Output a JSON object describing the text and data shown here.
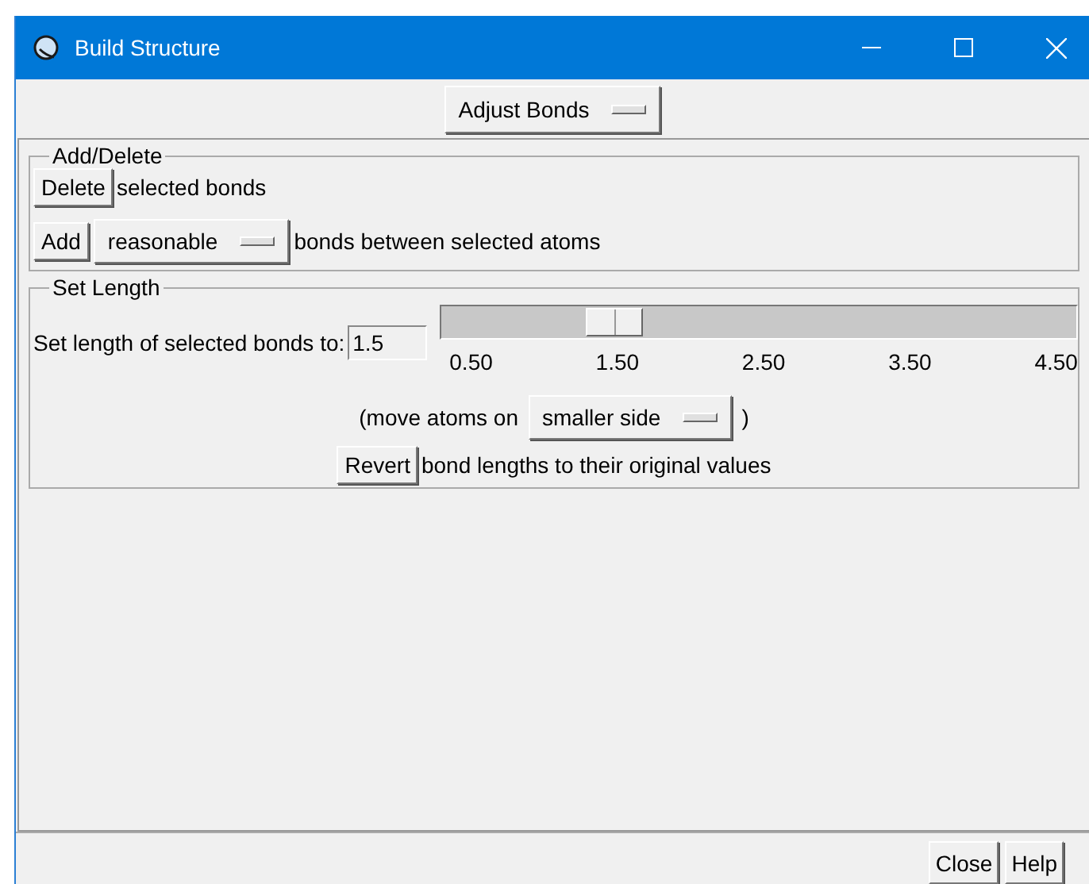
{
  "window": {
    "title": "Build Structure"
  },
  "mode_menu": {
    "value": "Adjust Bonds"
  },
  "add_delete": {
    "title": "Add/Delete",
    "delete_button": "Delete",
    "delete_text": "selected bonds",
    "add_button": "Add",
    "add_menu": "reasonable",
    "add_text": "bonds between selected atoms"
  },
  "set_length": {
    "title": "Set Length",
    "label": "Set length of selected bonds to:",
    "value": "1.5",
    "slider": {
      "level": 0.25,
      "ticks": [
        "0.50",
        "1.50",
        "2.50",
        "3.50",
        "4.50"
      ]
    },
    "move_prefix": "(move atoms on",
    "move_menu": "smaller side",
    "move_suffix": ")",
    "revert_button": "Revert",
    "revert_text": "bond lengths to their original values"
  },
  "buttons": [
    "Close",
    "Help"
  ]
}
